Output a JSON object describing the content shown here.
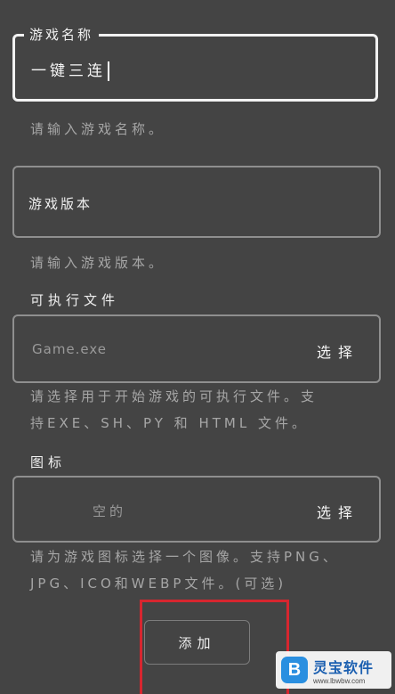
{
  "game_name": {
    "label": "游戏名称",
    "value": "一键三连",
    "helper": "请输入游戏名称。"
  },
  "game_version": {
    "placeholder": "游戏版本",
    "helper": "请输入游戏版本。"
  },
  "executable": {
    "section_label": "可执行文件",
    "placeholder": "Game.exe",
    "select_label": "选择",
    "helper_line1": "请选择用于开始游戏的可执行文件。支",
    "helper_line2": "持EXE、SH、PY 和 HTML 文件。"
  },
  "icon": {
    "section_label": "图标",
    "placeholder": "空的",
    "select_label": "选择",
    "helper_line1": "请为游戏图标选择一个图像。支持PNG、",
    "helper_line2": "JPG、ICO和WEBP文件。(可选)"
  },
  "add_button_label": "添加",
  "watermark": {
    "logo_letter": "B",
    "name": "灵宝软件",
    "url": "www.lbwbw.com"
  },
  "colors": {
    "background": "#444444",
    "highlight": "#d7262f",
    "watermark_blue": "#2a8fe0"
  }
}
